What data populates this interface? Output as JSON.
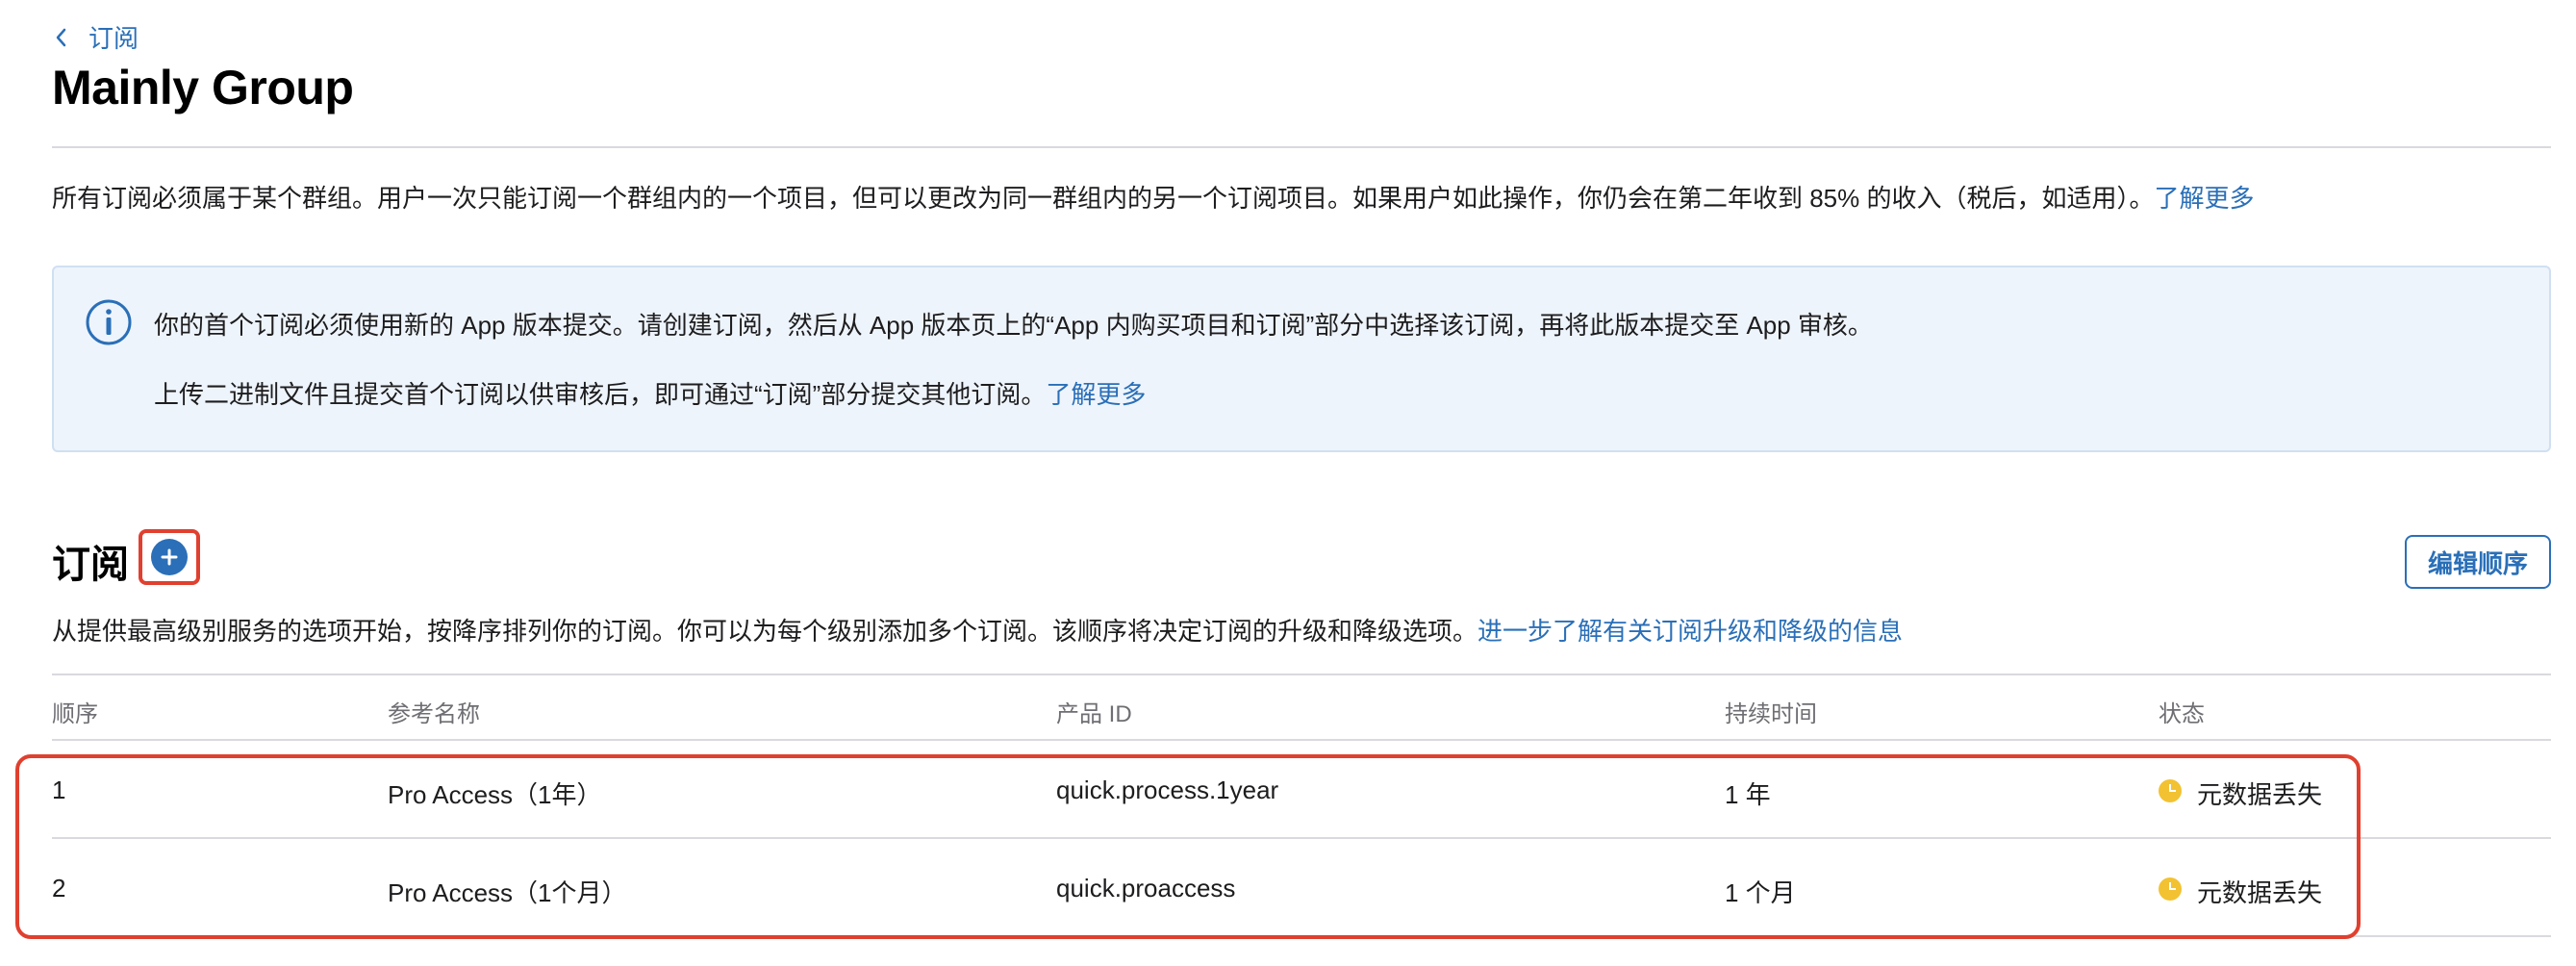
{
  "nav": {
    "back_label": "订阅"
  },
  "page": {
    "title": "Mainly Group"
  },
  "intro": {
    "text": "所有订阅必须属于某个群组。用户一次只能订阅一个群组内的一个项目，但可以更改为同一群组内的另一个订阅项目。如果用户如此操作，你仍会在第二年收到 85% 的收入（税后，如适用）。",
    "link": "了解更多"
  },
  "info_box": {
    "icon": "info-icon",
    "line1": "你的首个订阅必须使用新的 App 版本提交。请创建订阅，然后从 App 版本页上的“App 内购买项目和订阅”部分中选择该订阅，再将此版本提交至 App 审核。",
    "line2": "上传二进制文件且提交首个订阅以供审核后，即可通过“订阅”部分提交其他订阅。",
    "line2_link": "了解更多"
  },
  "subscriptions": {
    "title": "订阅",
    "add_icon": "plus-circle-icon",
    "edit_order_label": "编辑顺序",
    "description": "从提供最高级别服务的选项开始，按降序排列你的订阅。你可以为每个级别添加多个订阅。该顺序将决定订阅的升级和降级选项。",
    "description_link": "进一步了解有关订阅升级和降级的信息",
    "columns": [
      "顺序",
      "参考名称",
      "产品 ID",
      "持续时间",
      "状态"
    ],
    "rows": [
      {
        "order": "1",
        "name": "Pro Access（1年）",
        "product_id": "quick.process.1year",
        "duration": "1 年",
        "status": "元数据丢失"
      },
      {
        "order": "2",
        "name": "Pro Access（1个月）",
        "product_id": "quick.proaccess",
        "duration": "1 个月",
        "status": "元数据丢失"
      }
    ]
  },
  "colors": {
    "accent": "#2a6fb8",
    "highlight": "#e0402f",
    "status_warning": "#f2c232",
    "info_bg": "#eef4fb"
  }
}
